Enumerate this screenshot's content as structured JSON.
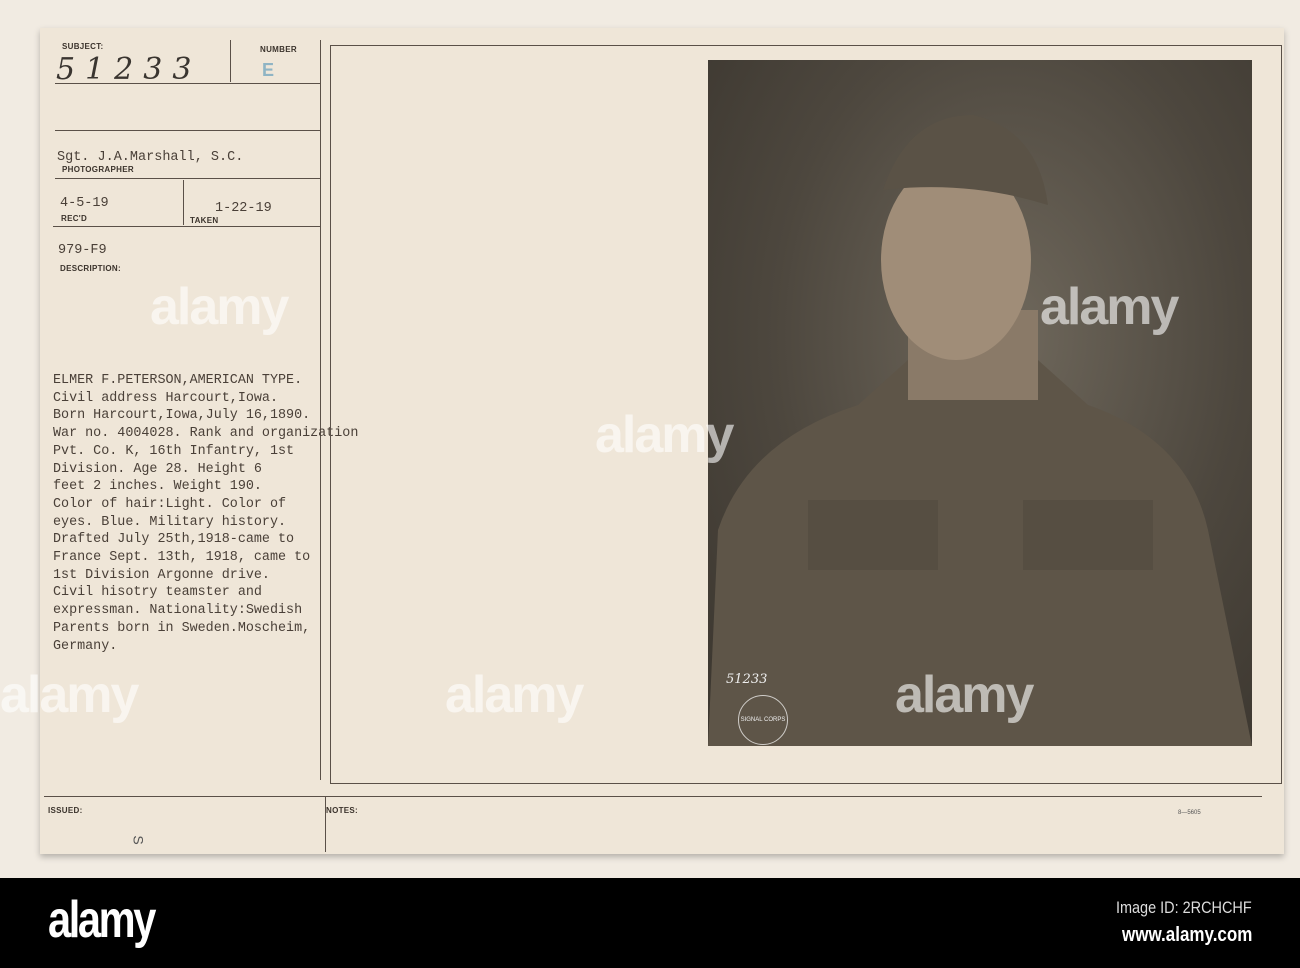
{
  "card": {
    "subject_label": "SUBJECT:",
    "subject_number": "51233",
    "number_label": "NUMBER",
    "number_stamp": "E",
    "photographer": "Sgt. J.A.Marshall, S.C.",
    "photographer_label": "PHOTOGRAPHER",
    "received": "4-5-19",
    "received_label": "REC'D",
    "taken": "1-22-19",
    "taken_label": "TAKEN",
    "file_code": "979-F9",
    "description_label": "DESCRIPTION:",
    "description_lines": [
      "ELMER F.PETERSON,AMERICAN TYPE.",
      "Civil address Harcourt,Iowa.",
      "Born Harcourt,Iowa,July 16,1890.",
      "War no. 4004028. Rank and organization",
      "Pvt. Co. K, 16th Infantry, 1st",
      "Division. Age 28. Height 6",
      "feet 2 inches. Weight 190.",
      "Color of hair:Light. Color of",
      "eyes. Blue. Military history.",
      "Drafted July 25th,1918-came to",
      "France Sept. 13th, 1918, came to",
      "1st Division Argonne drive.",
      "Civil hisotry teamster and",
      "expressman. Nationality:Swedish",
      "Parents born in Sweden.Moscheim,",
      "Germany."
    ],
    "issued_label": "ISSUED:",
    "issued_mark": "S",
    "notes_label": "NOTES:",
    "form_code": "8—5605"
  },
  "photo": {
    "negative_number": "51233",
    "stamp_text": "SIGNAL CORPS U.S.A."
  },
  "watermarks": [
    "alamy",
    "alamy",
    "alamy",
    "alamy",
    "alamy",
    "alamy"
  ],
  "footer": {
    "logo": "alamy",
    "image_id": "Image ID: 2RCHCHF",
    "url": "www.alamy.com"
  }
}
